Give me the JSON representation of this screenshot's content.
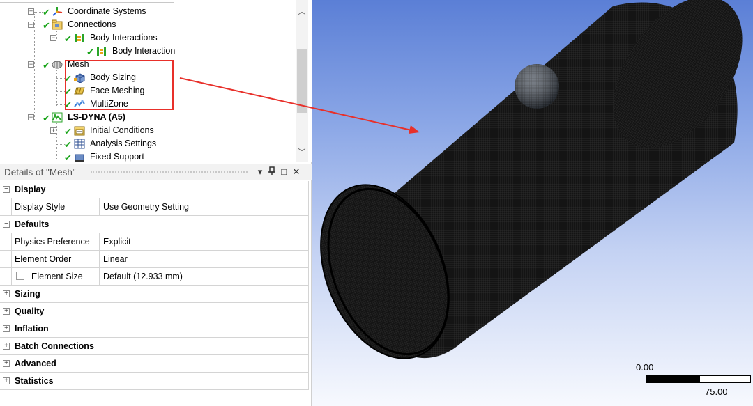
{
  "tree": {
    "items": [
      {
        "label": "Coordinate Systems"
      },
      {
        "label": "Connections"
      },
      {
        "label": "Body Interactions"
      },
      {
        "label": "Body Interaction"
      },
      {
        "label": "Mesh"
      },
      {
        "label": "Body Sizing"
      },
      {
        "label": "Face Meshing"
      },
      {
        "label": "MultiZone"
      },
      {
        "label": "LS-DYNA (A5)"
      },
      {
        "label": "Initial Conditions"
      },
      {
        "label": "Analysis Settings"
      },
      {
        "label": "Fixed Support"
      }
    ]
  },
  "details": {
    "title": "Details of \"Mesh\"",
    "buttons": {
      "dropdown": "▾",
      "pin": "📌",
      "maximize": "□",
      "close": "✕"
    },
    "rows": [
      {
        "section": "Display",
        "expanded": true
      },
      {
        "key": "Display Style",
        "value": "Use Geometry Setting"
      },
      {
        "section": "Defaults",
        "expanded": true
      },
      {
        "key": "Physics Preference",
        "value": "Explicit"
      },
      {
        "key": "Element Order",
        "value": "Linear"
      },
      {
        "key": "Element Size",
        "value": "Default (12.933 mm)"
      },
      {
        "section": "Sizing",
        "expanded": false
      },
      {
        "section": "Quality",
        "expanded": false
      },
      {
        "section": "Inflation",
        "expanded": false
      },
      {
        "section": "Batch Connections",
        "expanded": false
      },
      {
        "section": "Advanced",
        "expanded": false
      },
      {
        "section": "Statistics",
        "expanded": false
      }
    ]
  },
  "viewport": {
    "scale_left": "0.00",
    "scale_right": "75.00"
  },
  "colors": {
    "highlight": "#e8302a",
    "check": "#17a317",
    "mesh": "#111111"
  },
  "icons": {
    "check": "✔",
    "expand_plus": "+",
    "expand_minus": "−"
  }
}
